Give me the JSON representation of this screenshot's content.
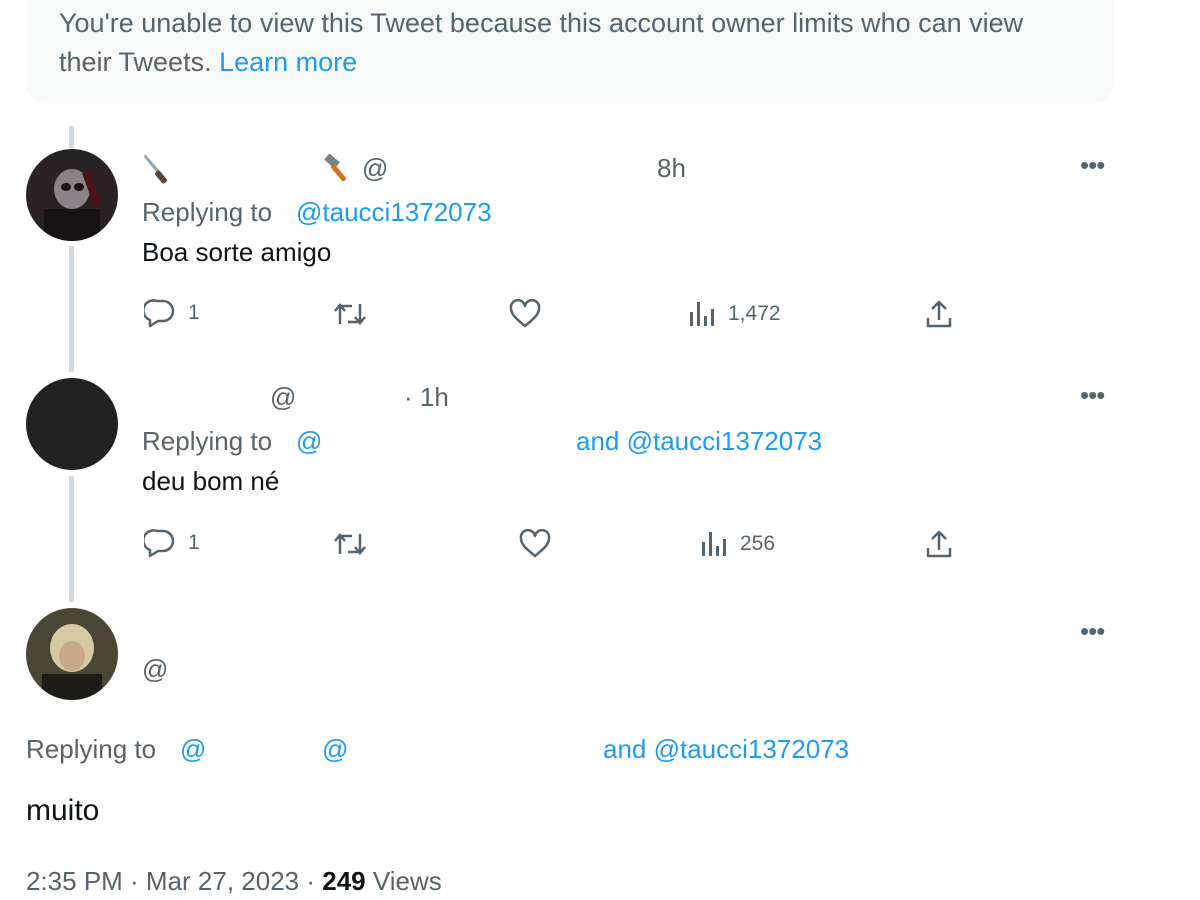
{
  "notice": {
    "text": "You're unable to view this Tweet because this account owner limits who can view their Tweets.",
    "link": "Learn more"
  },
  "tweets": [
    {
      "handle_prefix": "@",
      "time": "8h",
      "replying_prefix": "Replying to",
      "replying_handle": "@taucci1372073",
      "text": "Boa sorte amigo",
      "actions": {
        "reply_count": "1",
        "views": "1,472"
      }
    },
    {
      "handle_prefix": "@",
      "time": "· 1h",
      "replying_prefix": "Replying to",
      "replying_handle_1": "@",
      "replying_and": "and @taucci1372073",
      "text": "deu bom né",
      "actions": {
        "reply_count": "1",
        "views": "256"
      }
    }
  ],
  "main_tweet": {
    "handle_prefix": "@",
    "replying_prefix": "Replying to",
    "replying_handle_1": "@",
    "replying_handle_2": "@",
    "replying_and": "and @taucci1372073",
    "text": "muito",
    "timestamp": "2:35 PM · Mar 27, 2023 ·",
    "views_count": "249",
    "views_label": "Views"
  },
  "icons": {
    "more": "more-icon",
    "reply": "reply-icon",
    "retweet": "retweet-icon",
    "like": "like-icon",
    "views": "views-icon",
    "share": "share-icon"
  },
  "colors": {
    "link": "#1d9bf0",
    "secondary_text": "#536471",
    "text": "#0f1419"
  }
}
